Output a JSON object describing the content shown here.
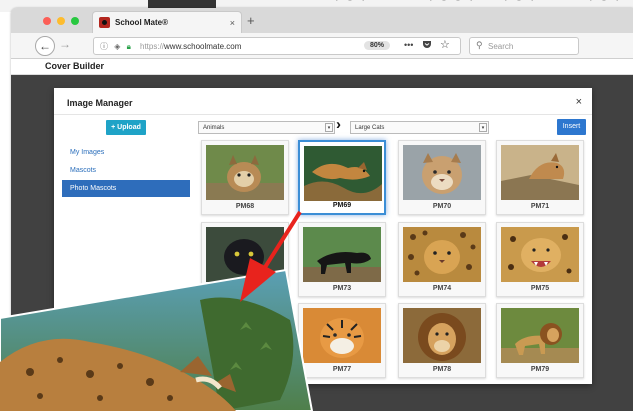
{
  "browser": {
    "tab_title": "School Mate®",
    "tab_close": "×",
    "new_tab": "+",
    "url_scheme": "https://",
    "url_host": "www.schoolmate.com",
    "zoom": "80%",
    "more": "•••",
    "search_placeholder": "Search",
    "traffic_lights": {
      "close": "#fc5f57",
      "minimize": "#fdbc2e",
      "maximize": "#28c840"
    }
  },
  "page": {
    "title": "Cover Builder"
  },
  "modal": {
    "title": "Image Manager",
    "close": "×",
    "upload_label": "+ Upload",
    "insert_label": "Insert",
    "category_select": "Animals",
    "subcategory_select": "Large Cats",
    "sidebar": [
      {
        "label": "My Images",
        "active": false
      },
      {
        "label": "Mascots",
        "active": false
      },
      {
        "label": "Photo Mascots",
        "active": true
      }
    ],
    "images": [
      {
        "label": "PM68",
        "selected": false,
        "animal": "bobcat"
      },
      {
        "label": "PM69",
        "selected": true,
        "animal": "leaping-cougar"
      },
      {
        "label": "PM70",
        "selected": false,
        "animal": "cougar-face"
      },
      {
        "label": "PM71",
        "selected": false,
        "animal": "cougar-rock"
      },
      {
        "label": "",
        "selected": false,
        "animal": "black-panther"
      },
      {
        "label": "PM73",
        "selected": false,
        "animal": "black-panther-walking"
      },
      {
        "label": "PM74",
        "selected": false,
        "animal": "leopard-face"
      },
      {
        "label": "PM75",
        "selected": false,
        "animal": "jaguar-snarl"
      },
      {
        "label": "",
        "selected": false,
        "animal": "hidden"
      },
      {
        "label": "PM77",
        "selected": false,
        "animal": "tiger-face"
      },
      {
        "label": "PM78",
        "selected": false,
        "animal": "lion-face"
      },
      {
        "label": "PM79",
        "selected": false,
        "animal": "lion-standing"
      }
    ]
  },
  "colors": {
    "accent": "#2e6dbb",
    "upload": "#1fa3c7",
    "callout_arrow": "#e8231d"
  }
}
